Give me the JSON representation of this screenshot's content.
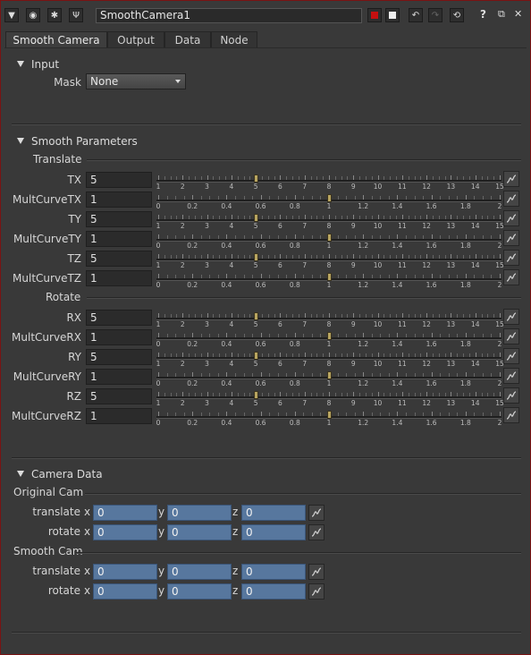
{
  "node": {
    "name": "SmoothCamera1"
  },
  "colors": {
    "border": "#7a1212",
    "accent_red": "#c41010",
    "blue_field": "#57779e",
    "slider_handle": "#b8a560"
  },
  "toolbar": {
    "left_icons": [
      "triangle-down-icon",
      "circle-icon",
      "wand-icon",
      "pin-icon"
    ],
    "right_icons": [
      "red-square-icon",
      "slash-square-icon",
      "undo-icon",
      "redo-icon",
      "revert-icon",
      "help-icon",
      "float-icon",
      "close-icon"
    ],
    "help_label": "?",
    "close_label": "✕",
    "float_label": "⧉"
  },
  "tabs": [
    "Smooth Camera",
    "Output",
    "Data",
    "Node"
  ],
  "input_section": {
    "title": "Input",
    "mask_label": "Mask",
    "mask_value": "None"
  },
  "smooth_section": {
    "title": "Smooth Parameters",
    "translate_label": "Translate",
    "rotate_label": "Rotate",
    "rows": [
      {
        "label": "TX",
        "value": "5",
        "type": "int",
        "level": 5
      },
      {
        "label": "MultCurveTX",
        "value": "1",
        "type": "float",
        "level": 1
      },
      {
        "label": "TY",
        "value": "5",
        "type": "int",
        "level": 5
      },
      {
        "label": "MultCurveTY",
        "value": "1",
        "type": "float",
        "level": 1
      },
      {
        "label": "TZ",
        "value": "5",
        "type": "int",
        "level": 5
      },
      {
        "label": "MultCurveTZ",
        "value": "1",
        "type": "float",
        "level": 1
      },
      {
        "label": "RX",
        "value": "5",
        "type": "int",
        "level": 5
      },
      {
        "label": "MultCurveRX",
        "value": "1",
        "type": "float",
        "level": 1
      },
      {
        "label": "RY",
        "value": "5",
        "type": "int",
        "level": 5
      },
      {
        "label": "MultCurveRY",
        "value": "1",
        "type": "float",
        "level": 1
      },
      {
        "label": "RZ",
        "value": "5",
        "type": "int",
        "level": 5
      },
      {
        "label": "MultCurveRZ",
        "value": "1",
        "type": "float",
        "level": 1
      }
    ],
    "int_ticks": [
      "1",
      "2",
      "3",
      "4",
      "5",
      "6",
      "7",
      "8",
      "9",
      "10",
      "11",
      "12",
      "13",
      "14",
      "15"
    ],
    "float_ticks": [
      "0",
      "0.2",
      "0.4",
      "0.6",
      "0.8",
      "1",
      "1.2",
      "1.4",
      "1.6",
      "1.8",
      "2"
    ]
  },
  "camera_section": {
    "title": "Camera Data",
    "groups": [
      {
        "title": "Original Cam",
        "rows": [
          {
            "label": "translate",
            "x": "0",
            "y": "0",
            "z": "0"
          },
          {
            "label": "rotate",
            "x": "0",
            "y": "0",
            "z": "0"
          }
        ]
      },
      {
        "title": "Smooth Cam",
        "rows": [
          {
            "label": "translate",
            "x": "0",
            "y": "0",
            "z": "0"
          },
          {
            "label": "rotate",
            "x": "0",
            "y": "0",
            "z": "0"
          }
        ]
      }
    ],
    "axis_labels": [
      "x",
      "y",
      "z"
    ]
  }
}
